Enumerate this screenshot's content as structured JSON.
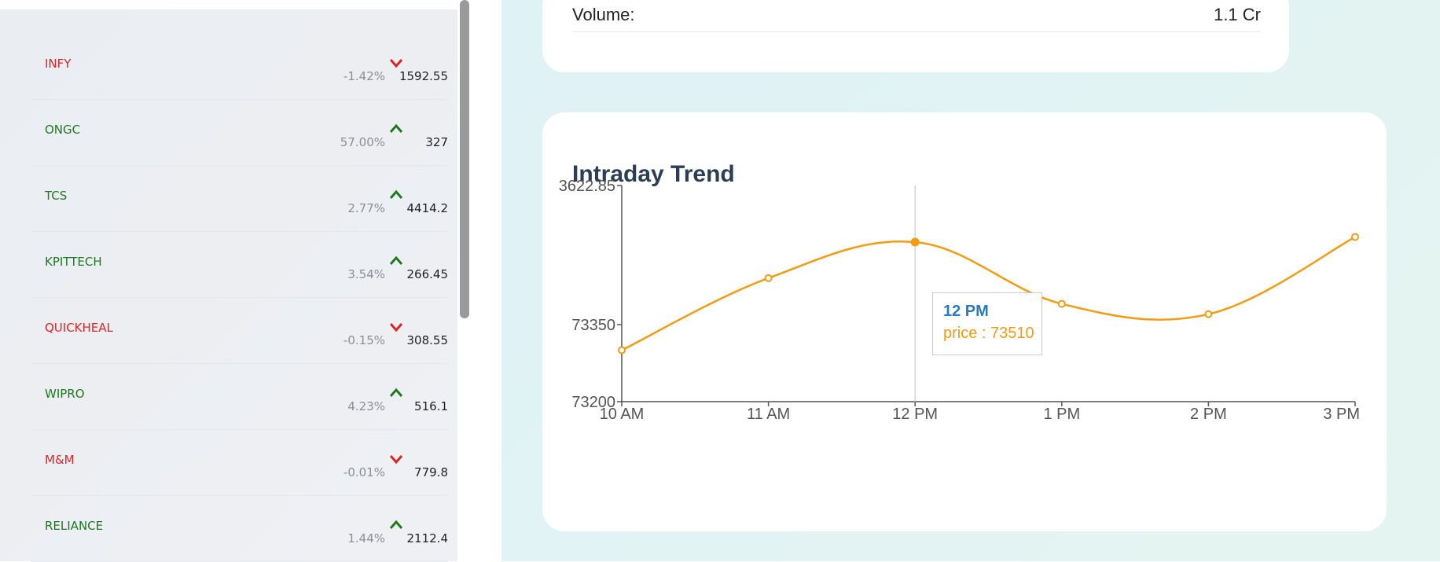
{
  "watchlist": [
    {
      "symbol": "INFY",
      "change": "-1.42%",
      "price": "1592.55",
      "direction": "down"
    },
    {
      "symbol": "ONGC",
      "change": "57.00%",
      "price": "327",
      "direction": "up"
    },
    {
      "symbol": "TCS",
      "change": "2.77%",
      "price": "4414.2",
      "direction": "up"
    },
    {
      "symbol": "KPITTECH",
      "change": "3.54%",
      "price": "266.45",
      "direction": "up"
    },
    {
      "symbol": "QUICKHEAL",
      "change": "-0.15%",
      "price": "308.55",
      "direction": "down"
    },
    {
      "symbol": "WIPRO",
      "change": "4.23%",
      "price": "516.1",
      "direction": "up"
    },
    {
      "symbol": "M&M",
      "change": "-0.01%",
      "price": "779.8",
      "direction": "down"
    },
    {
      "symbol": "RELIANCE",
      "change": "1.44%",
      "price": "2112.4",
      "direction": "up"
    }
  ],
  "details": {
    "volume_label": "Volume:",
    "volume_value": "1.1 Cr"
  },
  "trend": {
    "title": "Intraday Trend",
    "tooltip": {
      "time": "12 PM",
      "price_text": "price : 73510"
    }
  },
  "colors": {
    "up": "#1f7a1f",
    "down": "#e02424",
    "line": "#f39c12",
    "tooltip_time": "#2a7bbf"
  },
  "chart_data": {
    "type": "line",
    "categories": [
      "10 AM",
      "11 AM",
      "12 PM",
      "1 PM",
      "2 PM",
      "3 PM"
    ],
    "series": [
      {
        "values": [
          73300,
          73440,
          73510,
          73390,
          73370,
          73520
        ]
      }
    ],
    "y_ticks": [
      73200,
      73350,
      3622.85
    ],
    "y_tick_labels": [
      "73200",
      "73350",
      "3622.85"
    ],
    "ylim": [
      73200,
      73620
    ],
    "title": "Intraday Trend",
    "tooltip_index": 2,
    "grid": false
  }
}
